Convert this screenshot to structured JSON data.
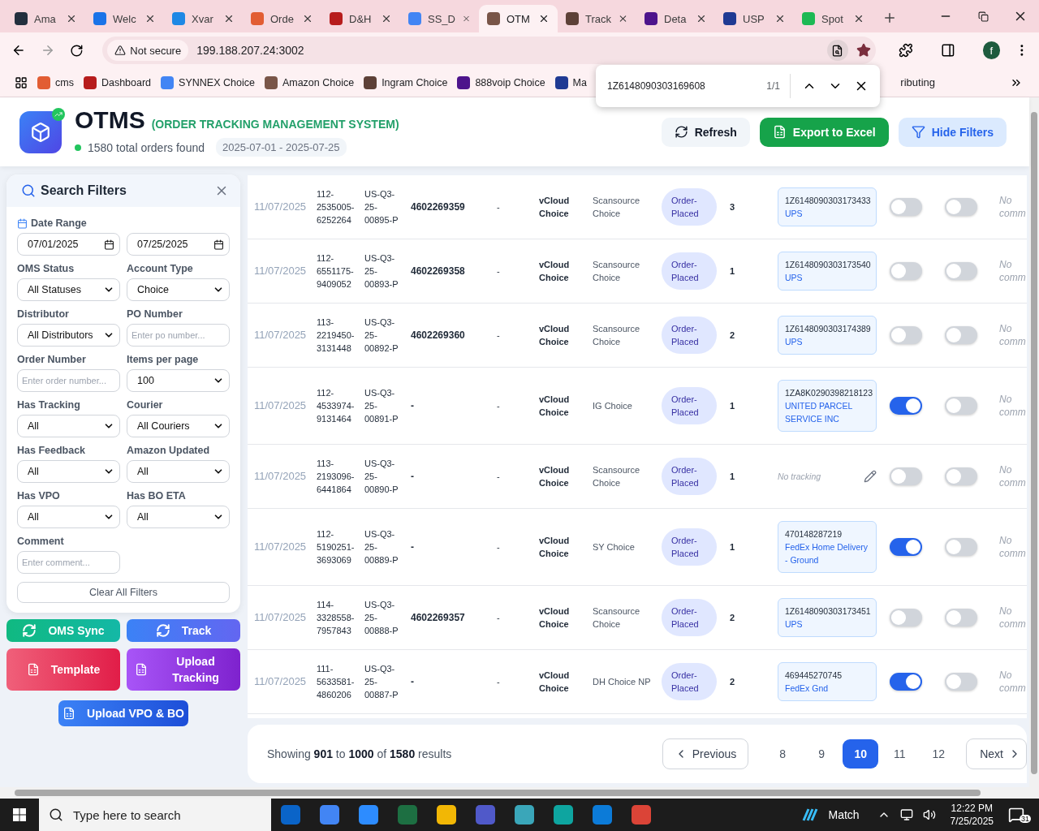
{
  "browser": {
    "tabs": [
      {
        "title": "Ama",
        "selected": false
      },
      {
        "title": "Welc",
        "selected": false
      },
      {
        "title": "Xvar",
        "selected": false
      },
      {
        "title": "Orde",
        "selected": false
      },
      {
        "title": "D&H",
        "selected": false
      },
      {
        "title": "SS_D",
        "selected": false
      },
      {
        "title": "OTM",
        "selected": true
      },
      {
        "title": "Track",
        "selected": false
      },
      {
        "title": "Deta",
        "selected": false
      },
      {
        "title": "USP",
        "selected": false
      },
      {
        "title": "Spot",
        "selected": false
      }
    ],
    "security": "Not secure",
    "url": "199.188.207.24:3002",
    "profile_initial": "f",
    "bookmarks": [
      {
        "label": "cms"
      },
      {
        "label": "Dashboard"
      },
      {
        "label": "SYNNEX Choice"
      },
      {
        "label": "Amazon Choice"
      },
      {
        "label": "Ingram Choice"
      },
      {
        "label": "888voip Choice"
      },
      {
        "label": "Ma"
      }
    ],
    "bookmark_fragment": "ributing",
    "find_bar": {
      "query": "1Z6148090303169608",
      "count": "1/1"
    }
  },
  "header": {
    "title": "OTMS",
    "subtitle": "(ORDER TRACKING MANAGEMENT SYSTEM)",
    "total": "1580 total orders found",
    "date_range": "2025-07-01 - 2025-07-25",
    "buttons": [
      {
        "label": "Refresh",
        "kind": "refresh"
      },
      {
        "label": "Export to Excel",
        "kind": "export"
      },
      {
        "label": "Hide Filters",
        "kind": "filter"
      }
    ]
  },
  "filters": {
    "title": "Search Filters",
    "date_label": "Date Range",
    "date_from": "07/01/2025",
    "date_to": "07/25/2025",
    "fields": [
      {
        "label": "OMS Status",
        "kind": "select",
        "value": "All Statuses"
      },
      {
        "label": "Account Type",
        "kind": "select",
        "value": "Choice"
      },
      {
        "label": "Distributor",
        "kind": "select",
        "value": "All Distributors"
      },
      {
        "label": "PO Number",
        "kind": "input",
        "placeholder": "Enter po number..."
      },
      {
        "label": "Order Number",
        "kind": "input",
        "placeholder": "Enter order number..."
      },
      {
        "label": "Items per page",
        "kind": "select",
        "value": "100"
      },
      {
        "label": "Has Tracking",
        "kind": "select",
        "value": "All"
      },
      {
        "label": "Courier",
        "kind": "select",
        "value": "All Couriers"
      },
      {
        "label": "Has Feedback",
        "kind": "select",
        "value": "All"
      },
      {
        "label": "Amazon Updated",
        "kind": "select",
        "value": "All"
      },
      {
        "label": "Has VPO",
        "kind": "select",
        "value": "All"
      },
      {
        "label": "Has BO ETA",
        "kind": "select",
        "value": "All"
      },
      {
        "label": "Comment",
        "kind": "input",
        "placeholder": "Enter comment..."
      }
    ],
    "clear_label": "Clear All Filters"
  },
  "actions": [
    {
      "label": "OMS Sync",
      "kind": "sync"
    },
    {
      "label": "Track",
      "kind": "track"
    },
    {
      "label": "Template",
      "kind": "template"
    },
    {
      "label": "Upload Tracking",
      "kind": "upload"
    },
    {
      "label": "Upload VPO & BO",
      "kind": "vpo"
    }
  ],
  "rows": [
    {
      "column_1": "11/07/2025",
      "column_2": "112-2535005-6252264",
      "column_3": "US-Q3-25-00895-P",
      "column_4": "4602269359",
      "column_5": "-",
      "column_6": "vCloud Choice",
      "column_7": "Scansource Choice",
      "column_8": "Order-Placed",
      "column_9": "3",
      "column_10": {
        "kind": "tracking",
        "number": "1Z6148090303173433",
        "courier": "UPS"
      },
      "column_11": {
        "on": false
      },
      "column_12": {
        "on": false
      },
      "column_13": "No comm"
    },
    {
      "column_1": "11/07/2025",
      "column_2": "112-6551175-9409052",
      "column_3": "US-Q3-25-00893-P",
      "column_4": "4602269358",
      "column_5": "-",
      "column_6": "vCloud Choice",
      "column_7": "Scansource Choice",
      "column_8": "Order-Placed",
      "column_9": "1",
      "column_10": {
        "kind": "tracking",
        "number": "1Z6148090303173540",
        "courier": "UPS"
      },
      "column_11": {
        "on": false
      },
      "column_12": {
        "on": false
      },
      "column_13": "No comm"
    },
    {
      "column_1": "11/07/2025",
      "column_2": "113-2219450-3131448",
      "column_3": "US-Q3-25-00892-P",
      "column_4": "4602269360",
      "column_5": "-",
      "column_6": "vCloud Choice",
      "column_7": "Scansource Choice",
      "column_8": "Order-Placed",
      "column_9": "2",
      "column_10": {
        "kind": "tracking",
        "number": "1Z6148090303174389",
        "courier": "UPS"
      },
      "column_11": {
        "on": false
      },
      "column_12": {
        "on": false
      },
      "column_13": "No comm"
    },
    {
      "column_1": "11/07/2025",
      "column_2": "112-4533974-9131464",
      "column_3": "US-Q3-25-00891-P",
      "column_4": "-",
      "column_5": "-",
      "column_6": "vCloud Choice",
      "column_7": "IG Choice",
      "column_8": "Order-Placed",
      "column_9": "1",
      "column_10": {
        "kind": "tracking",
        "number": "1ZA8K0290398218123",
        "courier": "UNITED PARCEL SERVICE INC"
      },
      "column_11": {
        "on": true
      },
      "column_12": {
        "on": false
      },
      "column_13": "No comm"
    },
    {
      "column_1": "11/07/2025",
      "column_2": "113-2193096-6441864",
      "column_3": "US-Q3-25-00890-P",
      "column_4": "-",
      "column_5": "-",
      "column_6": "vCloud Choice",
      "column_7": "Scansource Choice",
      "column_8": "Order-Placed",
      "column_9": "1",
      "column_10": {
        "kind": "none",
        "label": "No tracking"
      },
      "column_11": {
        "on": false
      },
      "column_12": {
        "on": false
      },
      "column_13": "No comm"
    },
    {
      "column_1": "11/07/2025",
      "column_2": "112-5190251-3693069",
      "column_3": "US-Q3-25-00889-P",
      "column_4": "-",
      "column_5": "-",
      "column_6": "vCloud Choice",
      "column_7": "SY Choice",
      "column_8": "Order-Placed",
      "column_9": "1",
      "column_10": {
        "kind": "tracking",
        "number": "470148287219",
        "courier": "FedEx Home Delivery - Ground"
      },
      "column_11": {
        "on": true
      },
      "column_12": {
        "on": false
      },
      "column_13": "No comm"
    },
    {
      "column_1": "11/07/2025",
      "column_2": "114-3328558-7957843",
      "column_3": "US-Q3-25-00888-P",
      "column_4": "4602269357",
      "column_5": "-",
      "column_6": "vCloud Choice",
      "column_7": "Scansource Choice",
      "column_8": "Order-Placed",
      "column_9": "2",
      "column_10": {
        "kind": "tracking",
        "number": "1Z6148090303173451",
        "courier": "UPS"
      },
      "column_11": {
        "on": false
      },
      "column_12": {
        "on": false
      },
      "column_13": "No comm"
    },
    {
      "column_1": "11/07/2025",
      "column_2": "111-5633581-4860206",
      "column_3": "US-Q3-25-00887-P",
      "column_4": "-",
      "column_5": "-",
      "column_6": "vCloud Choice",
      "column_7": "DH Choice NP",
      "column_8": "Order-Placed",
      "column_9": "2",
      "column_10": {
        "kind": "tracking",
        "number": "469445270745",
        "courier": "FedEx Gnd"
      },
      "column_11": {
        "on": true
      },
      "column_12": {
        "on": false
      },
      "column_13": "No comm"
    }
  ],
  "pagination": {
    "summary": "Showing **901** to **1000** of **1580** results",
    "previous": "Previous",
    "next": "Next",
    "pages": [
      {
        "label": "8",
        "selected": false
      },
      {
        "label": "9",
        "selected": false
      },
      {
        "label": "10",
        "selected": true
      },
      {
        "label": "11",
        "selected": false
      },
      {
        "label": "12",
        "selected": false
      }
    ]
  },
  "taskbar": {
    "search_placeholder": "Type here to search",
    "weather": "Match",
    "time": "12:22 PM",
    "date": "7/25/2025",
    "notifications": "31"
  }
}
